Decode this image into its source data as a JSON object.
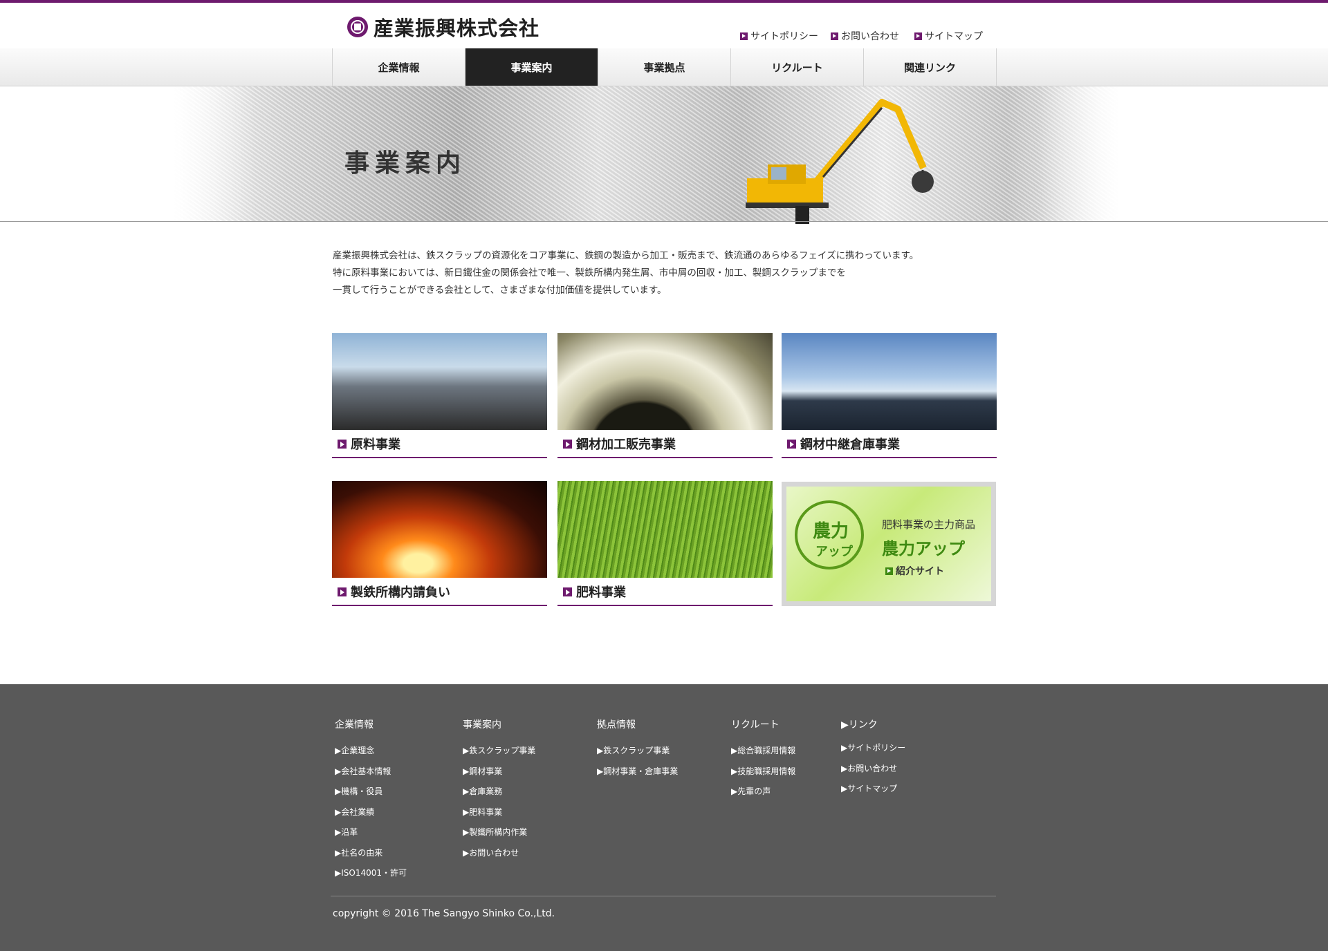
{
  "header": {
    "logo_text": "産業振興株式会社",
    "top_links": [
      {
        "label": "サイトポリシー"
      },
      {
        "label": "お問い合わせ"
      },
      {
        "label": "サイトマップ"
      }
    ]
  },
  "nav": {
    "items": [
      {
        "label": "企業情報"
      },
      {
        "label": "事業案内"
      },
      {
        "label": "事業拠点"
      },
      {
        "label": "リクルート"
      },
      {
        "label": "関連リンク"
      }
    ],
    "active_index": 1
  },
  "hero": {
    "title": "事業案内"
  },
  "intro": {
    "lines": [
      "産業振興株式会社は、鉄スクラップの資源化をコア事業に、鉄鋼の製造から加工・販売まで、鉄流通のあらゆるフェイズに携わっています。",
      "特に原料事業においては、新日鐵住金の関係会社で唯一、製鉄所構内発生屑、市中屑の回収・加工、製鋼スクラップまでを",
      "一貫して行うことができる会社として、さまざまな付加価値を提供しています。"
    ]
  },
  "cards": [
    {
      "label": "原料事業"
    },
    {
      "label": "鋼材加工販売事業"
    },
    {
      "label": "鋼材中継倉庫事業"
    },
    {
      "label": "製鉄所構内請負い"
    },
    {
      "label": "肥料事業"
    }
  ],
  "promo": {
    "logo_line1": "農力",
    "logo_line2": "アップ",
    "subtitle": "肥料事業の主力商品",
    "title": "農力アップ",
    "link": "紹介サイト"
  },
  "footer": {
    "columns": [
      {
        "heading": "企業情報",
        "links": [
          "▶企業理念",
          "▶会社基本情報",
          "▶機構・役員",
          "▶会社業績",
          "▶沿革",
          "▶社名の由来",
          "▶ISO14001・許可"
        ]
      },
      {
        "heading": "事業案内",
        "links": [
          "▶鉄スクラップ事業",
          "▶鋼材事業",
          "▶倉庫業務",
          "▶肥料事業",
          "▶製鐵所構内作業",
          "▶お問い合わせ"
        ]
      },
      {
        "heading": "拠点情報",
        "links": [
          "▶鉄スクラップ事業",
          "▶鋼材事業・倉庫事業"
        ]
      },
      {
        "heading": "リクルート",
        "links": [
          "▶総合職採用情報",
          "▶技能職採用情報",
          "▶先輩の声"
        ]
      },
      {
        "heading": "▶リンク",
        "links": [
          "▶サイトポリシー",
          "▶お問い合わせ",
          "▶サイトマップ"
        ]
      }
    ],
    "copyright": "copyright © 2016 The Sangyo Shinko Co.,Ltd."
  },
  "colors": {
    "accent": "#6e1a6e",
    "footer_bg": "#595959",
    "nav_active": "#222222",
    "promo_green": "#3f8a12"
  }
}
